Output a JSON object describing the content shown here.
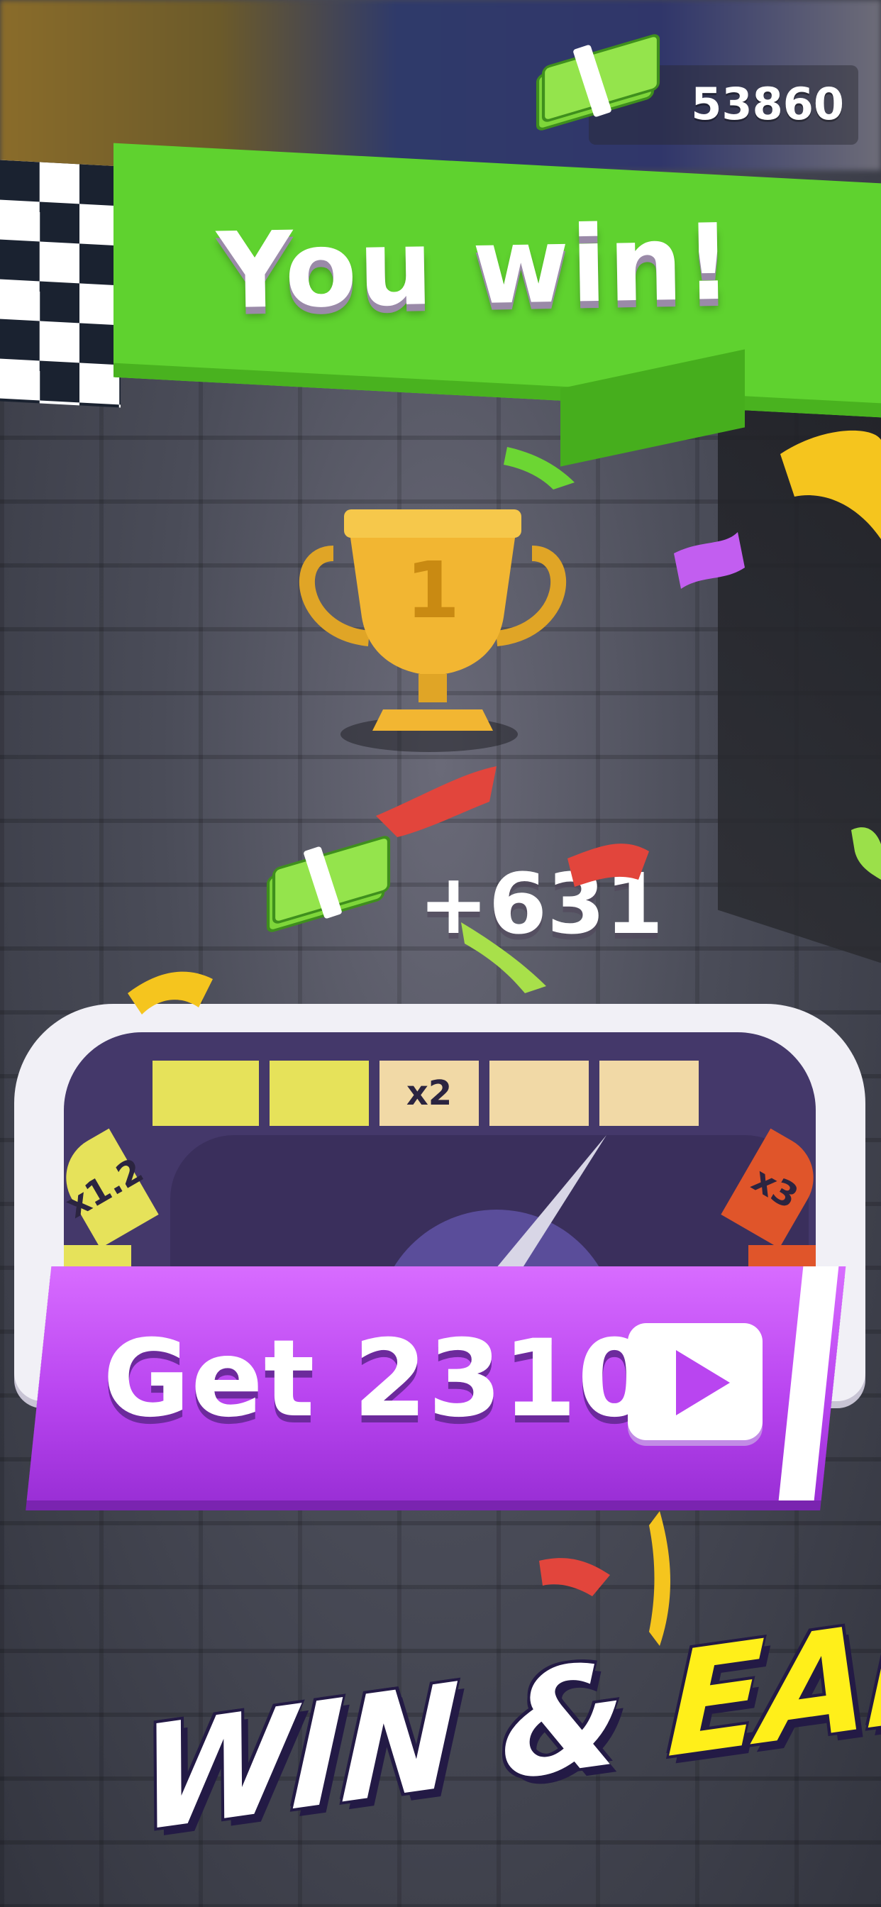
{
  "hud": {
    "cash_total": "53860",
    "cash_icon": "cash-stack-icon"
  },
  "banner": {
    "title": "You win!"
  },
  "trophy": {
    "place": "1",
    "icon": "trophy-icon"
  },
  "reward": {
    "gain": "+631",
    "icon": "cash-stack-icon"
  },
  "multiplier_meter": {
    "segments": [
      "x1.2",
      "",
      "",
      "x2",
      "",
      "",
      "x3"
    ],
    "colors": {
      "low": "#e6e25a",
      "mid": "#f1d9a6",
      "high": "#e0552a"
    }
  },
  "cta": {
    "label": "Get 2310",
    "icon": "play-icon"
  },
  "promo": {
    "part1": "WIN &",
    "part2": "EARN"
  },
  "colors": {
    "banner": "#5fd22f",
    "cta": "#b945f0",
    "promo_accent": "#ffef1a"
  }
}
